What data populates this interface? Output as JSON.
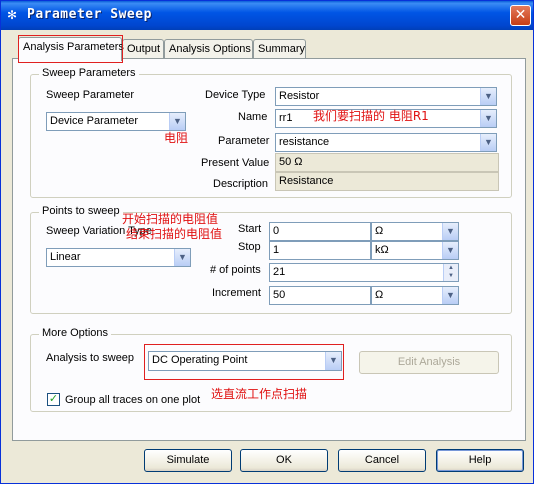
{
  "window": {
    "title": "Parameter Sweep",
    "close_glyph": "✕"
  },
  "tabs": [
    {
      "label": "Analysis Parameters",
      "active": true
    },
    {
      "label": "Output",
      "active": false
    },
    {
      "label": "Analysis Options",
      "active": false
    },
    {
      "label": "Summary",
      "active": false
    }
  ],
  "sweep_parameters": {
    "group_title": "Sweep Parameters",
    "sweep_parameter_label": "Sweep Parameter",
    "sweep_parameter_value": "Device Parameter",
    "device_type_label": "Device Type",
    "device_type_value": "Resistor",
    "name_label": "Name",
    "name_value": "rr1",
    "parameter_label": "Parameter",
    "parameter_value": "resistance",
    "present_value_label": "Present Value",
    "present_value": "50 Ω",
    "description_label": "Description",
    "description_value": "Resistance"
  },
  "points_to_sweep": {
    "group_title": "Points to sweep",
    "variation_label": "Sweep Variation Type",
    "variation_value": "Linear",
    "start_label": "Start",
    "start_value": "0",
    "start_unit": "Ω",
    "stop_label": "Stop",
    "stop_value": "1",
    "stop_unit": "kΩ",
    "points_label": "# of points",
    "points_value": "21",
    "increment_label": "Increment",
    "increment_value": "50",
    "increment_unit": "Ω"
  },
  "more_options": {
    "group_title": "More Options",
    "analysis_label": "Analysis to sweep",
    "analysis_value": "DC Operating Point",
    "edit_analysis_label": "Edit Analysis",
    "group_traces_label": "Group all traces on one plot",
    "group_traces_checked": true
  },
  "annotations": {
    "resistor": "电阻",
    "sweep_r1": "我们要扫描的 电阻R1",
    "start_r": "开始扫描的电阻值",
    "end_r": "结束扫描的电阻值",
    "dc_op": "选直流工作点扫描"
  },
  "buttons": {
    "simulate": "Simulate",
    "ok": "OK",
    "cancel": "Cancel",
    "help": "Help"
  },
  "colors": {
    "titlebar": "#0055e5",
    "dialog_bg": "#ece9d8",
    "annotation_red": "#e01010"
  }
}
